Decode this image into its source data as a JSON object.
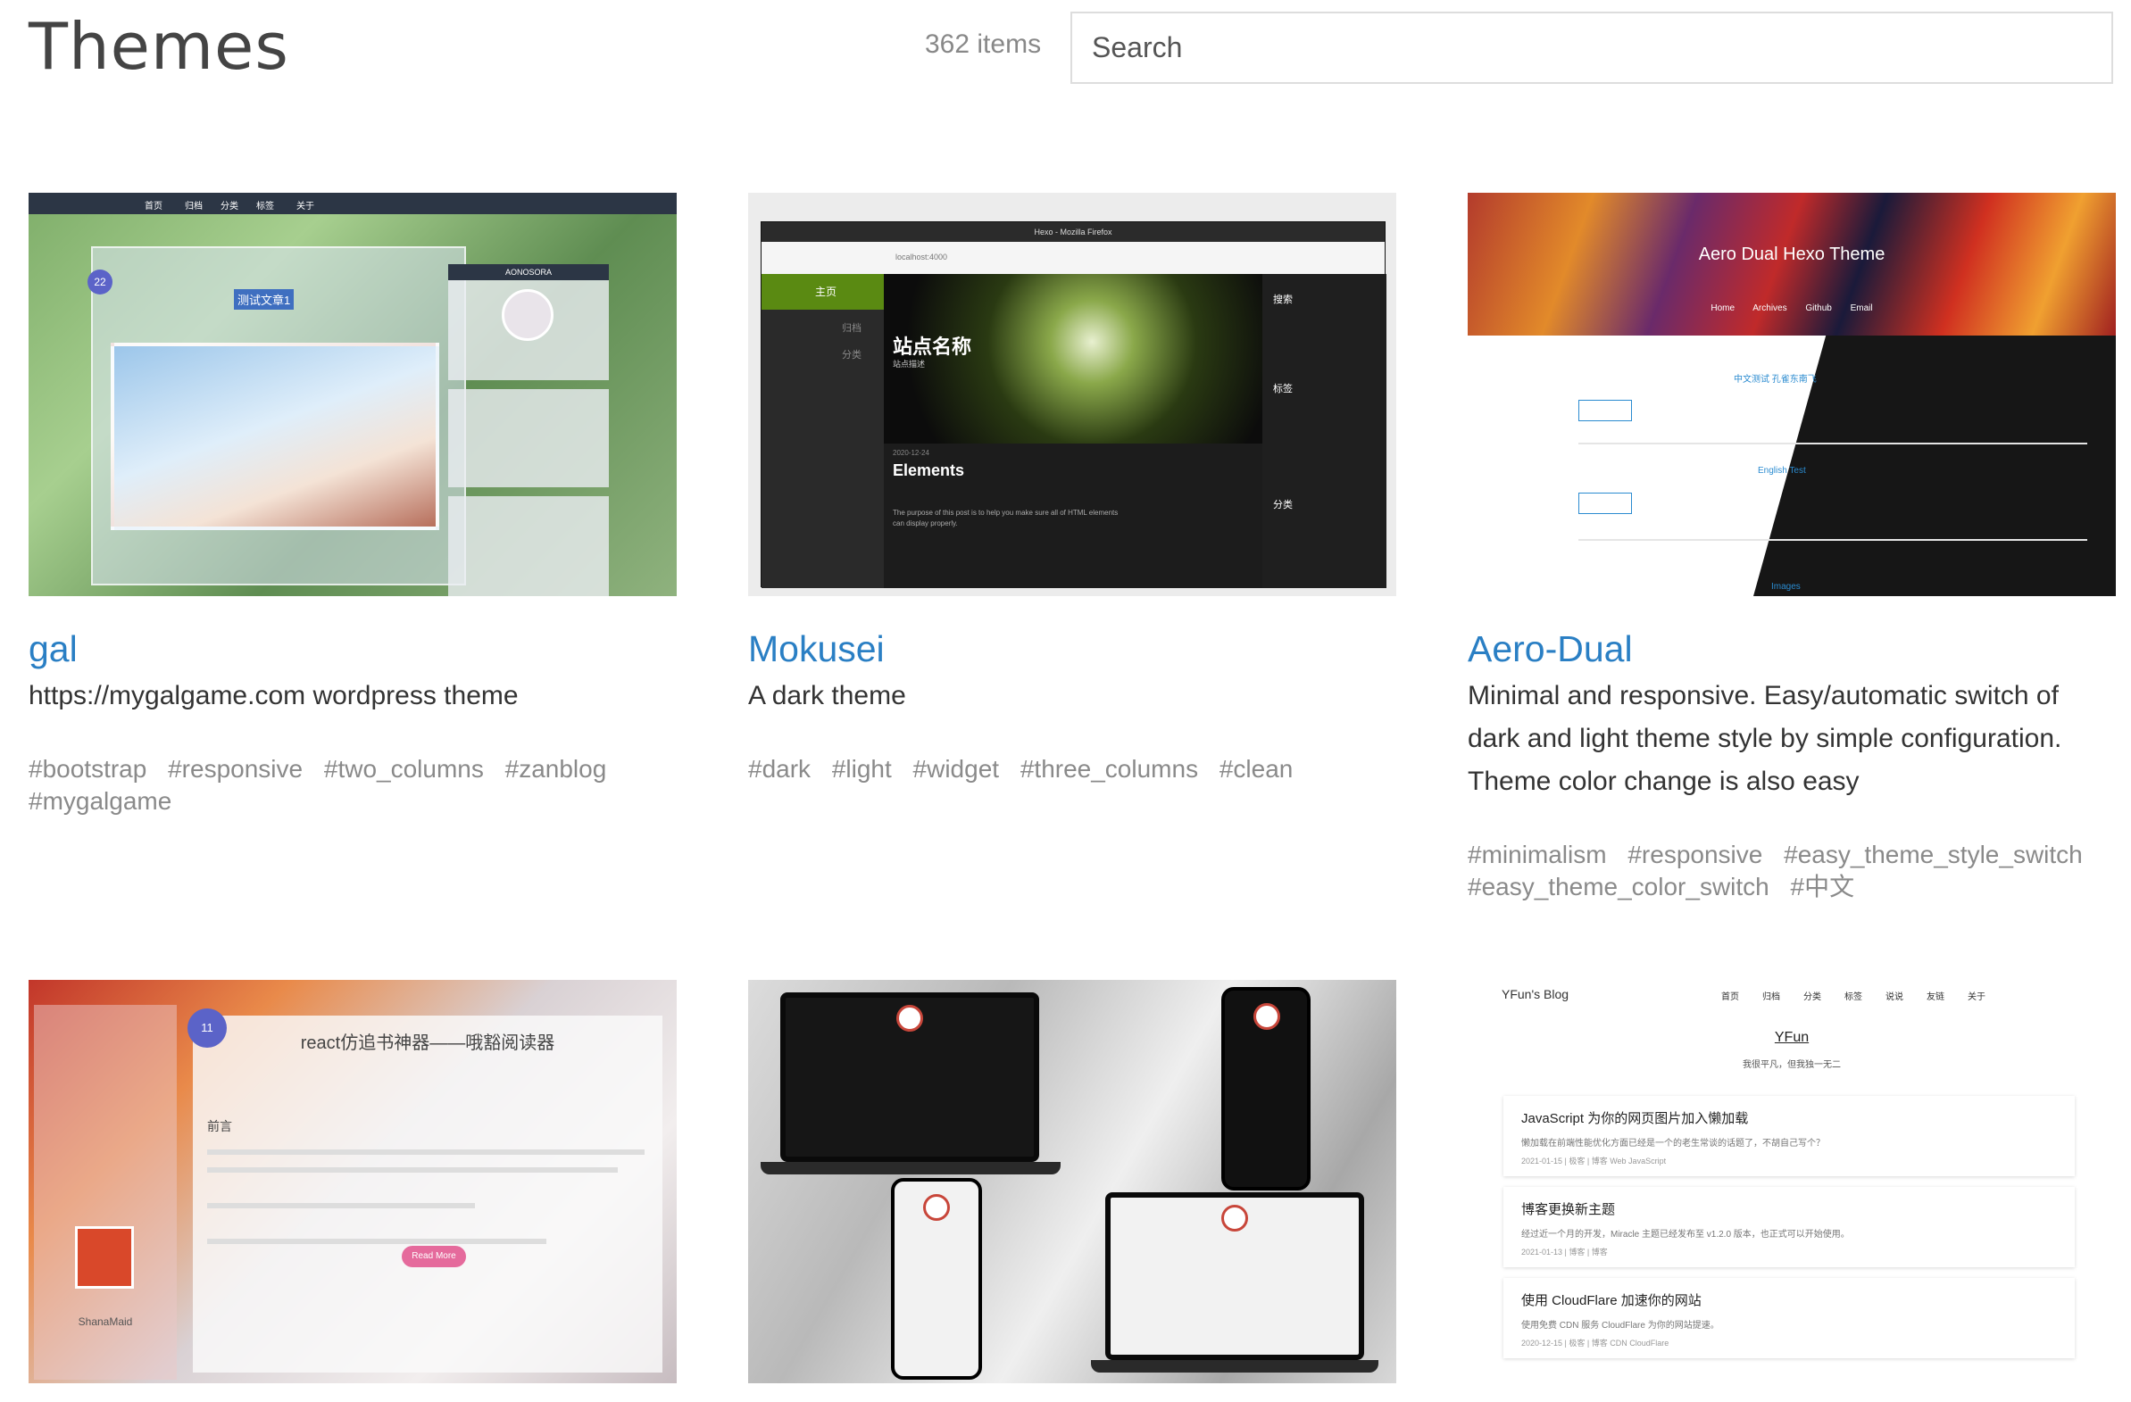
{
  "header": {
    "title": "Themes",
    "count": "362 items",
    "search_placeholder": "Search"
  },
  "themes": [
    {
      "name": "gal",
      "description": "https://mygalgame.com wordpress theme",
      "tags": [
        "#bootstrap",
        "#responsive",
        "#two_columns",
        "#zanblog",
        "#mygalgame"
      ],
      "screenshot": {
        "nav": [
          "首页",
          "归档",
          "分类",
          "标签",
          "关于"
        ],
        "date_badge": "22",
        "post_title": "测试文章1",
        "sidebar_name": "AONOSORA"
      }
    },
    {
      "name": "Mokusei",
      "description": "A dark theme",
      "tags": [
        "#dark",
        "#light",
        "#widget",
        "#three_columns",
        "#clean"
      ],
      "screenshot": {
        "window_title": "Hexo - Mozilla Firefox",
        "url": "localhost:4000",
        "nav_active": "主页",
        "nav_items": [
          "归档",
          "分类"
        ],
        "site_name": "站点名称",
        "site_desc": "站点描述",
        "post_date": "2020-12-24",
        "post_title": "Elements",
        "post_excerpt": "The purpose of this post is to help you make sure all of HTML elements can display properly.",
        "right_sections": [
          "搜索",
          "标签",
          "分类"
        ]
      }
    },
    {
      "name": "Aero-Dual",
      "description": "Minimal and responsive. Easy/automatic switch of dark and light theme style by simple configuration. Theme color change is also easy",
      "tags": [
        "#minimalism",
        "#responsive",
        "#easy_theme_style_switch",
        "#easy_theme_color_switch",
        "#中文"
      ],
      "screenshot": {
        "title": "Aero Dual Hexo Theme",
        "menu": "Home Archives Github Email",
        "post1_title": "中文测试 孔雀东南飞",
        "post2_title": "English Test",
        "footer": "Images"
      }
    },
    {
      "name": "",
      "description": "",
      "tags": [],
      "screenshot": {
        "date_badge": "11",
        "post_title": "react仿追书神器——哦豁阅读器",
        "section": "前言",
        "button": "Read More",
        "profile_name": "ShanaMaid"
      }
    },
    {
      "name": "",
      "description": "",
      "tags": [],
      "screenshot": {}
    },
    {
      "name": "",
      "description": "",
      "tags": [],
      "screenshot": {
        "blog_title": "YFun's Blog",
        "nav": [
          "首页",
          "归档",
          "分类",
          "标签",
          "说说",
          "友链",
          "关于"
        ],
        "site_name": "YFun",
        "subtitle": "我很平凡，但我独一无二",
        "posts": [
          {
            "title": "JavaScript 为你的网页图片加入懒加载",
            "summary": "懒加载在前端性能优化方面已经是一个的老生常谈的话题了，不胡自己写个？",
            "meta": "2021-01-15 | 极客 | 博客 Web JavaScript"
          },
          {
            "title": "博客更换新主题",
            "summary": "经过近一个月的开发，Miracle 主题已经发布至 v1.2.0 版本，也正式可以开始使用。",
            "meta": "2021-01-13 | 博客 | 博客"
          },
          {
            "title": "使用 CloudFlare 加速你的网站",
            "summary": "使用免费 CDN 服务 CloudFlare 为你的网站提速。",
            "meta": "2020-12-15 | 极客 | 博客 CDN CloudFlare"
          }
        ]
      }
    }
  ]
}
